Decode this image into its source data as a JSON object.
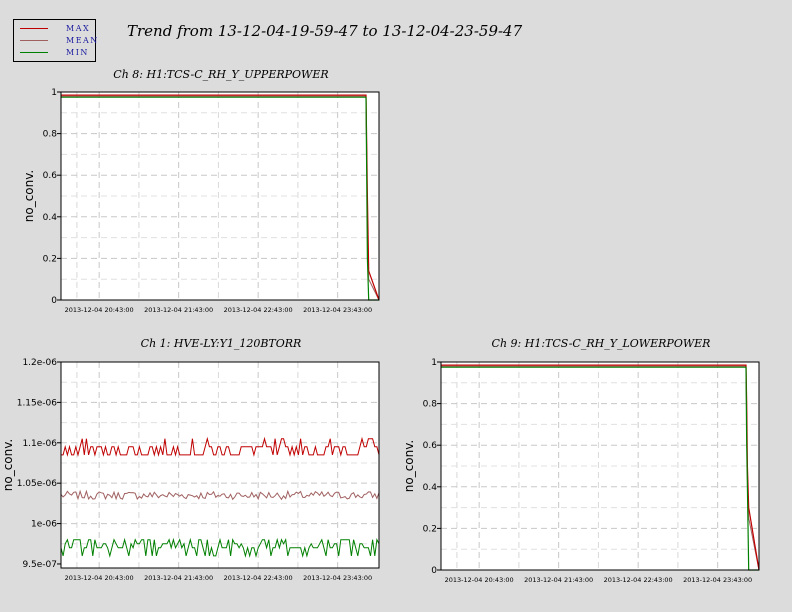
{
  "page": {
    "title": "Trend from 13-12-04-19-59-47 to 13-12-04-23-59-47"
  },
  "legend": {
    "items": [
      {
        "label": "MAX",
        "color": "#c00000"
      },
      {
        "label": "MEAN",
        "color": "#a06060"
      },
      {
        "label": "MIN",
        "color": "#008000"
      }
    ]
  },
  "chart_data": [
    {
      "type": "line",
      "title": "Ch 8: H1:TCS-C_RH_Y_UPPERPOWER",
      "ylabel": "no_conv.",
      "xlabel": "",
      "ylim": [
        0,
        1
      ],
      "yticks": [
        "0",
        "0.2",
        "0.4",
        "0.6",
        "0.8",
        "1"
      ],
      "xticks": [
        "2013-12-04 20:43:00",
        "2013-12-04 21:43:00",
        "2013-12-04 22:43:00",
        "2013-12-04 23:43:00"
      ],
      "grid": true,
      "series": [
        {
          "name": "MAX",
          "x": [
            "19:59:47",
            "23:50:00",
            "23:50:30",
            "23:51:00",
            "23:52:00",
            "23:59:47"
          ],
          "values": [
            0.985,
            0.985,
            0.75,
            0.5,
            0.14,
            0.0
          ]
        },
        {
          "name": "MEAN",
          "x": [
            "19:59:47",
            "23:50:00",
            "23:50:30",
            "23:51:00",
            "23:52:00",
            "23:59:47"
          ],
          "values": [
            0.98,
            0.98,
            0.7,
            0.4,
            0.1,
            0.0
          ]
        },
        {
          "name": "MIN",
          "x": [
            "19:59:47",
            "23:50:00",
            "23:50:30",
            "23:51:00",
            "23:52:00",
            "23:59:47"
          ],
          "values": [
            0.975,
            0.975,
            0.6,
            0.2,
            0.0,
            0.0
          ]
        }
      ]
    },
    {
      "type": "line",
      "title": "Ch 1: HVE-LY:Y1_120BTORR",
      "ylabel": "no_conv.",
      "xlabel": "",
      "ylim": [
        9.45e-07,
        1.2e-06
      ],
      "yticks": [
        "9.5e-07",
        "1e-06",
        "1.05e-06",
        "1.1e-06",
        "1.15e-06",
        "1.2e-06"
      ],
      "xticks": [
        "2013-12-04 20:43:00",
        "2013-12-04 21:43:00",
        "2013-12-04 22:43:00",
        "2013-12-04 23:43:00"
      ],
      "grid": true,
      "series": [
        {
          "name": "MAX",
          "approx_level": 1.09e-06,
          "approx_range": [
            1.08e-06,
            1.11e-06
          ]
        },
        {
          "name": "MEAN",
          "approx_level": 1.035e-06,
          "approx_range": [
            1.03e-06,
            1.04e-06
          ]
        },
        {
          "name": "MIN",
          "approx_level": 9.7e-07,
          "approx_range": [
            9.45e-07,
            9.85e-07
          ]
        }
      ]
    },
    {
      "type": "line",
      "title": "Ch 9: H1:TCS-C_RH_Y_LOWERPOWER",
      "ylabel": "no_conv.",
      "xlabel": "",
      "ylim": [
        0,
        1
      ],
      "yticks": [
        "0",
        "0.2",
        "0.4",
        "0.6",
        "0.8",
        "1"
      ],
      "xticks": [
        "2013-12-04 20:43:00",
        "2013-12-04 21:43:00",
        "2013-12-04 22:43:00",
        "2013-12-04 23:43:00"
      ],
      "grid": true,
      "series": [
        {
          "name": "MAX",
          "x": [
            "19:59:47",
            "23:50:00",
            "23:50:30",
            "23:51:00",
            "23:52:00",
            "23:59:47"
          ],
          "values": [
            0.985,
            0.985,
            0.8,
            0.5,
            0.3,
            0.0
          ]
        },
        {
          "name": "MEAN",
          "x": [
            "19:59:47",
            "23:50:00",
            "23:50:30",
            "23:51:00",
            "23:52:00",
            "23:59:47"
          ],
          "values": [
            0.98,
            0.98,
            0.7,
            0.45,
            0.25,
            0.0
          ]
        },
        {
          "name": "MIN",
          "x": [
            "19:59:47",
            "23:50:00",
            "23:50:30",
            "23:51:00",
            "23:52:00",
            "23:59:47"
          ],
          "values": [
            0.975,
            0.975,
            0.6,
            0.4,
            0.0,
            0.0
          ]
        }
      ]
    }
  ]
}
